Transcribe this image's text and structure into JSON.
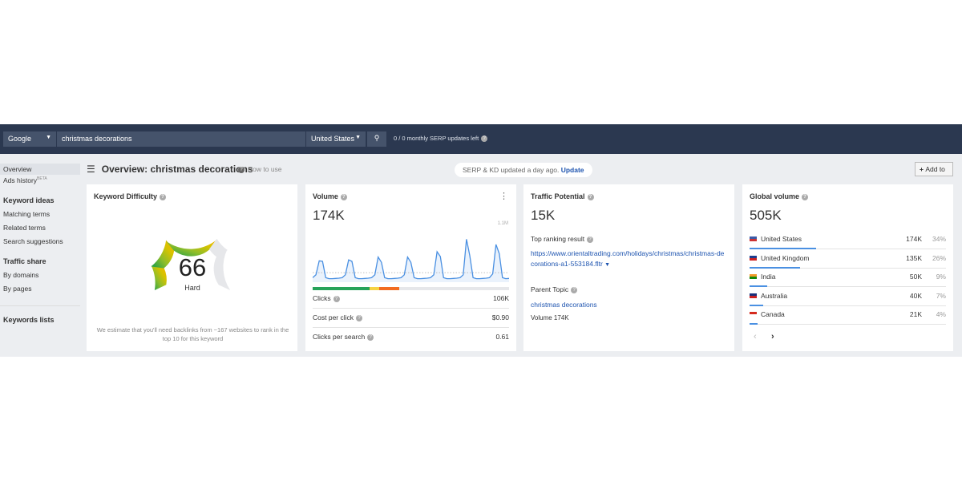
{
  "search": {
    "engine": "Google",
    "query": "christmas decorations",
    "country": "United States",
    "serp_updates": "0 / 0 monthly SERP updates left"
  },
  "sidebar": {
    "items": [
      {
        "label": "Overview",
        "type": "item",
        "active": true
      },
      {
        "label": "Ads history",
        "badge": "BETA",
        "type": "item"
      },
      {
        "label": "Keyword ideas",
        "type": "header"
      },
      {
        "label": "Matching terms",
        "type": "item"
      },
      {
        "label": "Related terms",
        "type": "item"
      },
      {
        "label": "Search suggestions",
        "type": "item"
      },
      {
        "label": "Traffic share",
        "type": "header"
      },
      {
        "label": "By domains",
        "type": "item"
      },
      {
        "label": "By pages",
        "type": "item"
      },
      {
        "label": "Keywords lists",
        "type": "header"
      }
    ]
  },
  "header": {
    "title": "Overview: christmas decorations",
    "how_to": "How to use",
    "status": "SERP & KD updated a day ago.",
    "update": "Update",
    "add_to": "Add to"
  },
  "kd": {
    "title": "Keyword Difficulty",
    "value": 66,
    "label": "Hard",
    "note": "We estimate that you'll need backlinks from ~167 websites to rank in the top 10 for this keyword"
  },
  "volume": {
    "title": "Volume",
    "value": "174K",
    "chart_max_label": "1.1M",
    "trend_k": [
      60,
      120,
      410,
      400,
      60,
      40,
      40,
      45,
      50,
      60,
      120,
      430,
      400,
      60,
      40,
      40,
      45,
      50,
      60,
      120,
      490,
      380,
      60,
      40,
      40,
      45,
      50,
      60,
      120,
      490,
      380,
      60,
      40,
      40,
      45,
      50,
      60,
      120,
      600,
      500,
      60,
      40,
      40,
      45,
      50,
      60,
      120,
      860,
      520,
      60,
      40,
      40,
      45,
      50,
      60,
      140,
      750,
      560,
      60,
      40,
      45
    ],
    "clicks_split": {
      "organic": 0.29,
      "paid": 0.05,
      "other": 0.1
    },
    "rows": [
      {
        "label": "Clicks",
        "value": "106K"
      },
      {
        "label": "Cost per click",
        "value": "$0.90"
      },
      {
        "label": "Clicks per search",
        "value": "0.61"
      }
    ]
  },
  "tp": {
    "title": "Traffic Potential",
    "value": "15K",
    "top_result_label": "Top ranking result",
    "top_result_url": "https://www.orientaltrading.com/holidays/christmas/christmas-decorations-a1-553184.fltr",
    "parent_label": "Parent Topic",
    "parent_topic": "christmas decorations",
    "parent_volume": "Volume 174K"
  },
  "global": {
    "title": "Global volume",
    "value": "505K",
    "countries": [
      {
        "name": "United States",
        "volume": "174K",
        "pct": "34%",
        "share": 34
      },
      {
        "name": "United Kingdom",
        "volume": "135K",
        "pct": "26%",
        "share": 26
      },
      {
        "name": "India",
        "volume": "50K",
        "pct": "9%",
        "share": 9
      },
      {
        "name": "Australia",
        "volume": "40K",
        "pct": "7%",
        "share": 7
      },
      {
        "name": "Canada",
        "volume": "21K",
        "pct": "4%",
        "share": 4
      }
    ]
  },
  "colors": {
    "topbar": "#2b3850",
    "link": "#1f55b0",
    "line": "#4a90e2",
    "green": "#27a35a",
    "yellow": "#f6d344",
    "orange": "#f26c21"
  }
}
